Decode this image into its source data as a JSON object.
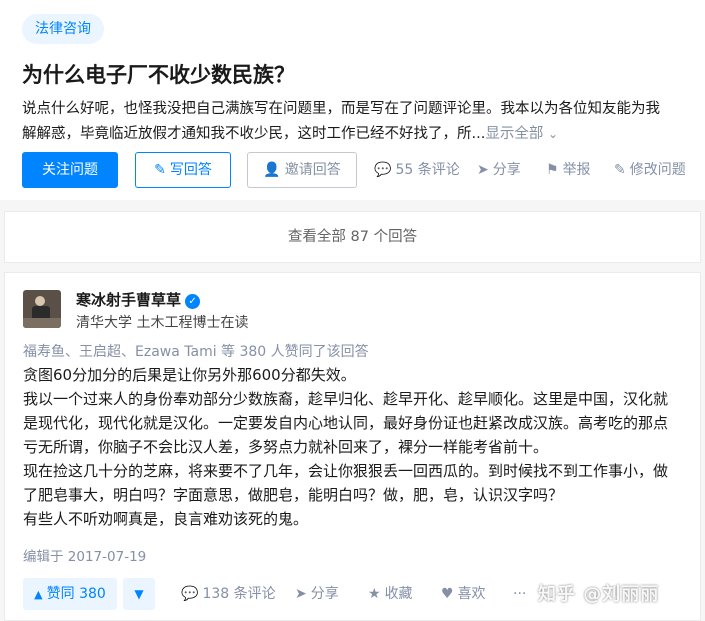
{
  "question": {
    "topic": "法律咨询",
    "title": "为什么电子厂不收少数民族？",
    "detail_line1": "说点什么好呢，也怪我没把自己满族写在问题里，而是写在了问题评论里。我本以为各位知友能为我",
    "detail_line2": "解解惑，毕竟临近放假才通知我不收少民，这时工作已经不好找了，所...",
    "show_all": "显示全部",
    "buttons": {
      "follow": "关注问题",
      "write": "写回答",
      "invite": "邀请回答"
    },
    "meta": {
      "comments": "55 条评论",
      "share": "分享",
      "report": "举报",
      "edit": "修改问题"
    }
  },
  "view_all": "查看全部 87 个回答",
  "answer": {
    "author": "寒冰射手曹草草",
    "headline": "清华大学 土木工程博士在读",
    "voters": "福寿鱼、王启超、Ezawa Tami 等 380 人赞同了该回答",
    "paragraphs": [
      "贪图60分加分的后果是让你另外那600分都失效。",
      "我以一个过来人的身份奉劝部分少数族裔，趁早归化、趁早开化、趁早顺化。这里是中国，汉化就",
      "是现代化，现代化就是汉化。一定要发自内心地认同，最好身份证也赶紧改成汉族。高考吃的那点",
      "亏无所谓，你脑子不会比汉人差，多努点力就补回来了，裸分一样能考省前十。",
      "现在捡这几十分的芝麻，将来要不了几年，会让你狠狠丢一回西瓜的。到时候找不到工作事小，做",
      "了肥皂事大，明白吗？字面意思，做肥皂，能明白吗？做，肥，皂，认识汉字吗？",
      "有些人不听劝啊真是，良言难劝该死的鬼。"
    ],
    "edited": "编辑于 2017-07-19",
    "vote_label": "赞同 380",
    "actions": {
      "comments": "138 条评论",
      "share": "分享",
      "favorite": "收藏",
      "like": "喜欢"
    }
  },
  "watermark": "知乎 @刘丽丽",
  "colors": {
    "accent": "#0084ff",
    "muted": "#8590a6",
    "accent_bg": "#ebf5ff"
  }
}
